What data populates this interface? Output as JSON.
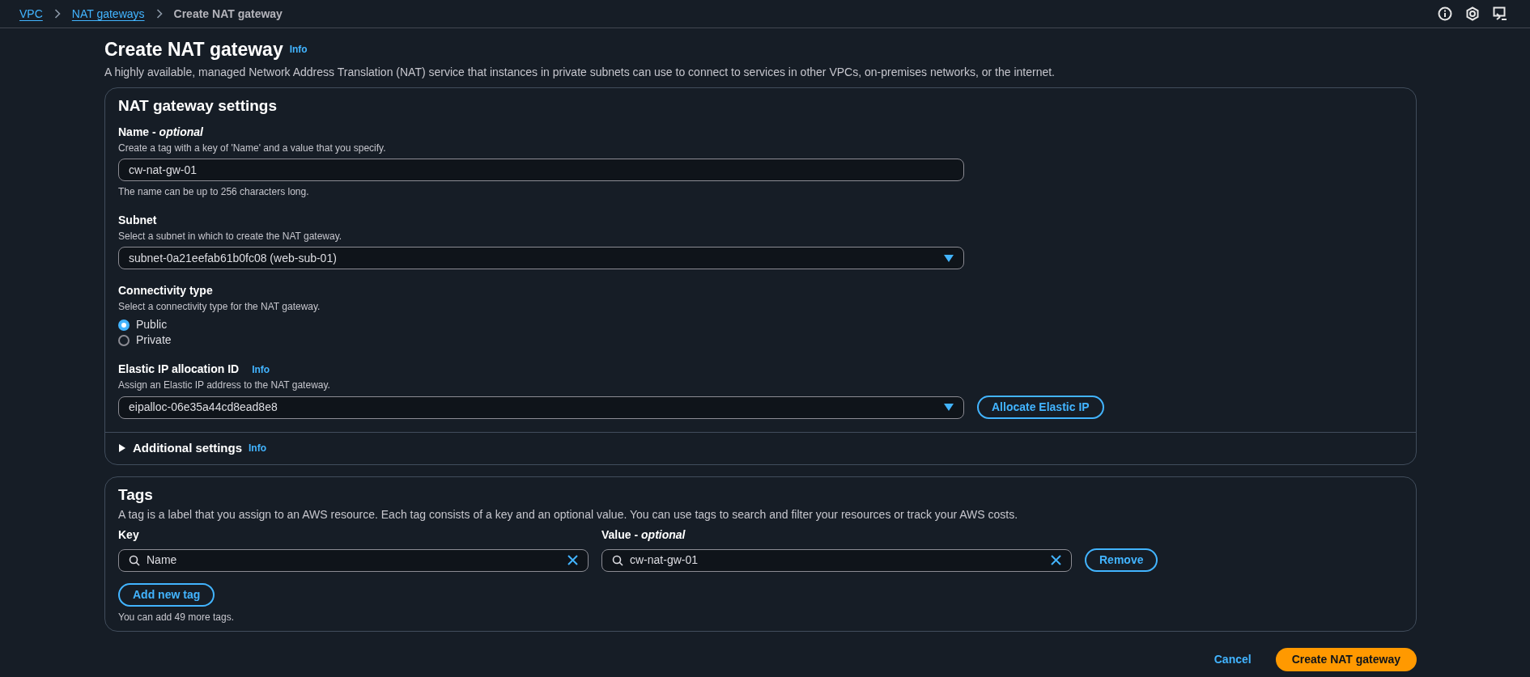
{
  "breadcrumbs": [
    {
      "label": "VPC",
      "kind": "link"
    },
    {
      "label": "NAT gateways",
      "kind": "link"
    },
    {
      "label": "Create NAT gateway",
      "kind": "current"
    }
  ],
  "header": {
    "title": "Create NAT gateway",
    "info": "Info",
    "description": "A highly available, managed Network Address Translation (NAT) service that instances in private subnets can use to connect to services in other VPCs, on-premises networks, or the internet."
  },
  "settings": {
    "title": "NAT gateway settings",
    "name": {
      "label": "Name - *optional*",
      "description": "Create a tag with a key of 'Name' and a value that you specify.",
      "value": "cw-nat-gw-01",
      "hint": "The name can be up to 256 characters long."
    },
    "subnet": {
      "label": "Subnet",
      "description": "Select a subnet in which to create the NAT gateway.",
      "value": "subnet-0a21eefab61b0fc08 (web-sub-01)"
    },
    "connectivity": {
      "label": "Connectivity type",
      "description": "Select a connectivity type for the NAT gateway.",
      "options": [
        {
          "label": "Public",
          "selected": true
        },
        {
          "label": "Private",
          "selected": false
        }
      ]
    },
    "elastic_ip": {
      "label": "Elastic IP allocation ID",
      "info": "Info",
      "description": "Assign an Elastic IP address to the NAT gateway.",
      "value": "eipalloc-06e35a44cd8ead8e8",
      "button": "Allocate Elastic IP"
    },
    "additional": {
      "label": "Additional settings",
      "info": "Info",
      "expanded": false
    }
  },
  "tags": {
    "title": "Tags",
    "description": "A tag is a label that you assign to an AWS resource. Each tag consists of a key and an optional value. You can use tags to search and filter your resources or track your AWS costs.",
    "key_label": "Key",
    "value_label": "Value - *optional*",
    "rows": [
      {
        "key": "Name",
        "value": "cw-nat-gw-01",
        "remove": "Remove"
      }
    ],
    "add_button": "Add new tag",
    "hint": "You can add 49 more tags."
  },
  "footer": {
    "cancel": "Cancel",
    "submit": "Create NAT gateway"
  }
}
